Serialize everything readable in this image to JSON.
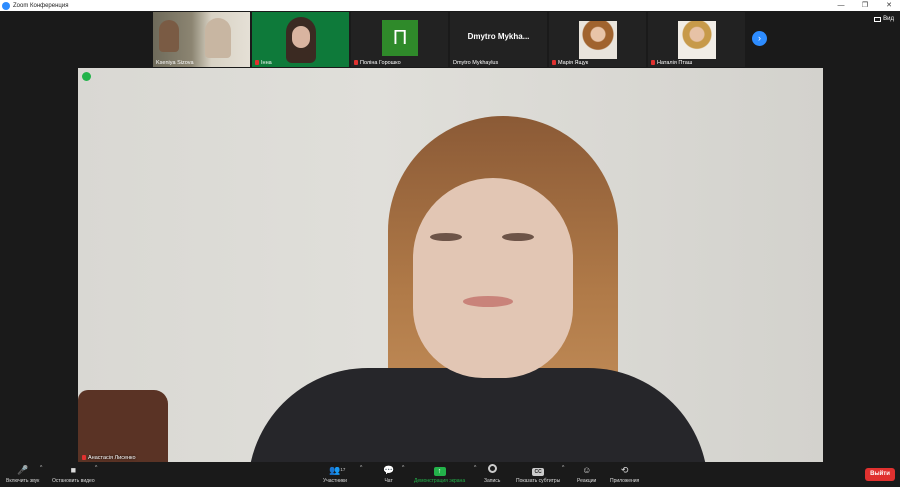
{
  "window": {
    "title": "Zoom Конференция",
    "minimize": "—",
    "restore": "❐",
    "close": "✕"
  },
  "view_button": {
    "label": "Вид"
  },
  "participants_strip": [
    {
      "name": "Kseniya Sizova",
      "muted": false
    },
    {
      "name": "Інна",
      "muted": true
    },
    {
      "name": "Поліна Горошко",
      "muted": true,
      "avatar_letter": "П"
    },
    {
      "name": "Dmytro   Mykhaylus",
      "muted": false,
      "display_text": "Dmytro    Mykha..."
    },
    {
      "name": "Марія  Ящук",
      "muted": true
    },
    {
      "name": "Наталія Пташ",
      "muted": true
    }
  ],
  "next_page_glyph": "›",
  "main_video": {
    "name": "Анастасія Лисенко",
    "muted": true
  },
  "toolbar": {
    "unmute": "Включить звук",
    "stop_video": "Остановить видео",
    "participants": "Участники",
    "participants_count": "17",
    "chat": "Чат",
    "share_screen": "Демонстрация экрана",
    "record": "Запись",
    "subtitles": "Показать субтитры",
    "cc": "CC",
    "reactions": "Реакции",
    "apps": "Приложения",
    "leave": "Выйти"
  },
  "colors": {
    "accent": "#2d8cff",
    "share_green": "#23b34a",
    "leave_red": "#e0312f",
    "toolbar_bg": "#1a1a1a"
  }
}
